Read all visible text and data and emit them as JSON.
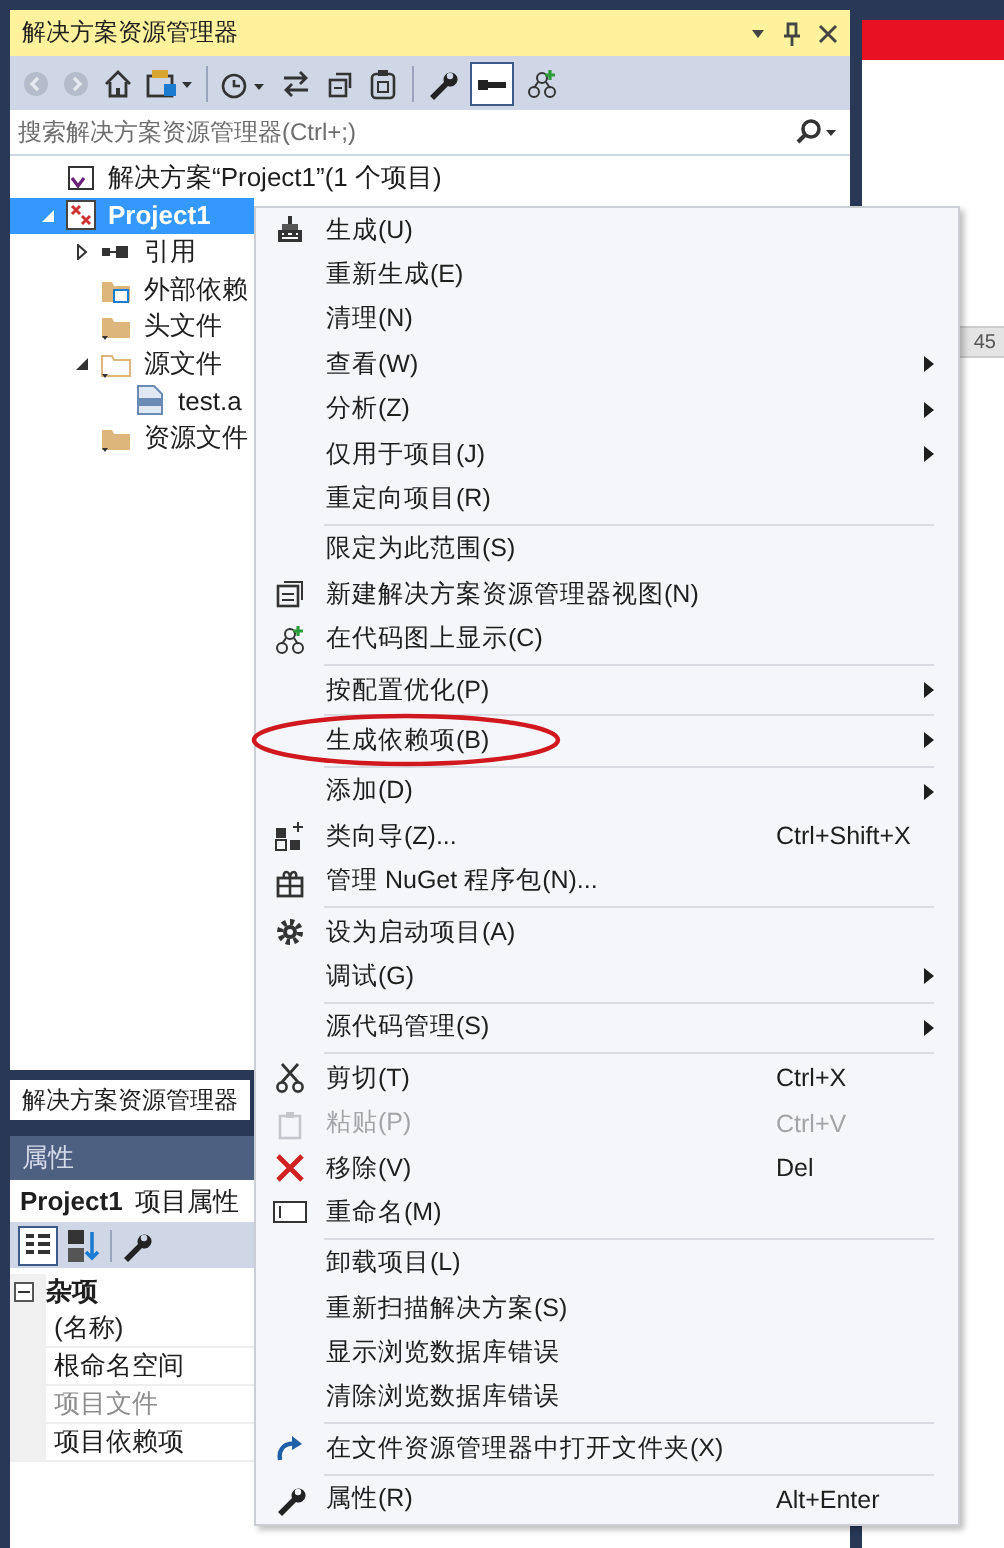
{
  "solution_explorer": {
    "title": "解决方案资源管理器",
    "search": {
      "placeholder": "搜索解决方案资源管理器(Ctrl+;)"
    },
    "tree": [
      {
        "label": "解决方案“Project1”(1 个项目)",
        "selected": false
      },
      {
        "label": "Project1",
        "selected": true,
        "expanded": true,
        "children": [
          {
            "label": "引用",
            "selected": false,
            "expanded": false
          },
          {
            "label": "外部依赖",
            "selected": false
          },
          {
            "label": "头文件",
            "selected": false
          },
          {
            "label": "源文件",
            "selected": false,
            "expanded": true,
            "children": [
              {
                "label": "test.a",
                "selected": false
              }
            ]
          },
          {
            "label": "资源文件",
            "selected": false
          }
        ]
      }
    ],
    "tab": "解决方案资源管理器"
  },
  "properties": {
    "title": "属性",
    "object": "Project1",
    "object_type": "项目属性",
    "category": "杂项",
    "category_expanded": true,
    "rows": [
      {
        "name": "(名称)",
        "disabled": false
      },
      {
        "name": "根命名空间",
        "disabled": false
      },
      {
        "name": "项目文件",
        "disabled": true
      },
      {
        "name": "项目依赖项",
        "disabled": false
      }
    ]
  },
  "background_window": {
    "label": "45"
  },
  "context_menu": [
    {
      "kind": "item",
      "label": "生成(U)",
      "submenu": false,
      "disabled": false,
      "circled": false
    },
    {
      "kind": "item",
      "label": "重新生成(E)",
      "submenu": false,
      "disabled": false,
      "circled": false
    },
    {
      "kind": "item",
      "label": "清理(N)",
      "submenu": false,
      "disabled": false,
      "circled": false
    },
    {
      "kind": "item",
      "label": "查看(W)",
      "submenu": true,
      "disabled": false,
      "circled": false
    },
    {
      "kind": "item",
      "label": "分析(Z)",
      "submenu": true,
      "disabled": false,
      "circled": false
    },
    {
      "kind": "item",
      "label": "仅用于项目(J)",
      "submenu": true,
      "disabled": false,
      "circled": false
    },
    {
      "kind": "item",
      "label": "重定向项目(R)",
      "submenu": false,
      "disabled": false,
      "circled": false
    },
    {
      "kind": "separator"
    },
    {
      "kind": "item",
      "label": "限定为此范围(S)",
      "submenu": false,
      "disabled": false,
      "circled": false
    },
    {
      "kind": "item",
      "label": "新建解决方案资源管理器视图(N)",
      "submenu": false,
      "disabled": false,
      "circled": false
    },
    {
      "kind": "item",
      "label": "在代码图上显示(C)",
      "submenu": false,
      "disabled": false,
      "circled": false
    },
    {
      "kind": "separator"
    },
    {
      "kind": "item",
      "label": "按配置优化(P)",
      "submenu": true,
      "disabled": false,
      "circled": false
    },
    {
      "kind": "separator"
    },
    {
      "kind": "item",
      "label": "生成依赖项(B)",
      "submenu": true,
      "disabled": false,
      "circled": true
    },
    {
      "kind": "separator"
    },
    {
      "kind": "item",
      "label": "添加(D)",
      "submenu": true,
      "disabled": false,
      "circled": false
    },
    {
      "kind": "item",
      "label": "类向导(Z)...",
      "shortcut": "Ctrl+Shift+X",
      "submenu": false,
      "disabled": false,
      "circled": false
    },
    {
      "kind": "item",
      "label": "管理 NuGet 程序包(N)...",
      "submenu": false,
      "disabled": false,
      "circled": false
    },
    {
      "kind": "separator"
    },
    {
      "kind": "item",
      "label": "设为启动项目(A)",
      "submenu": false,
      "disabled": false,
      "circled": false
    },
    {
      "kind": "item",
      "label": "调试(G)",
      "submenu": true,
      "disabled": false,
      "circled": false
    },
    {
      "kind": "separator"
    },
    {
      "kind": "item",
      "label": "源代码管理(S)",
      "submenu": true,
      "disabled": false,
      "circled": false
    },
    {
      "kind": "separator"
    },
    {
      "kind": "item",
      "label": "剪切(T)",
      "shortcut": "Ctrl+X",
      "submenu": false,
      "disabled": false,
      "circled": false
    },
    {
      "kind": "item",
      "label": "粘贴(P)",
      "shortcut": "Ctrl+V",
      "submenu": false,
      "disabled": true,
      "circled": false
    },
    {
      "kind": "item",
      "label": "移除(V)",
      "shortcut": "Del",
      "submenu": false,
      "disabled": false,
      "circled": false
    },
    {
      "kind": "item",
      "label": "重命名(M)",
      "submenu": false,
      "disabled": false,
      "circled": false
    },
    {
      "kind": "separator"
    },
    {
      "kind": "item",
      "label": "卸载项目(L)",
      "submenu": false,
      "disabled": false,
      "circled": false
    },
    {
      "kind": "item",
      "label": "重新扫描解决方案(S)",
      "submenu": false,
      "disabled": false,
      "circled": false
    },
    {
      "kind": "item",
      "label": "显示浏览数据库错误",
      "submenu": false,
      "disabled": false,
      "circled": false
    },
    {
      "kind": "item",
      "label": "清除浏览数据库错误",
      "submenu": false,
      "disabled": false,
      "circled": false
    },
    {
      "kind": "separator"
    },
    {
      "kind": "item",
      "label": "在文件资源管理器中打开文件夹(X)",
      "submenu": false,
      "disabled": false,
      "circled": false
    },
    {
      "kind": "separator"
    },
    {
      "kind": "item",
      "label": "属性(R)",
      "shortcut": "Alt+Enter",
      "submenu": false,
      "disabled": false,
      "circled": false
    }
  ]
}
